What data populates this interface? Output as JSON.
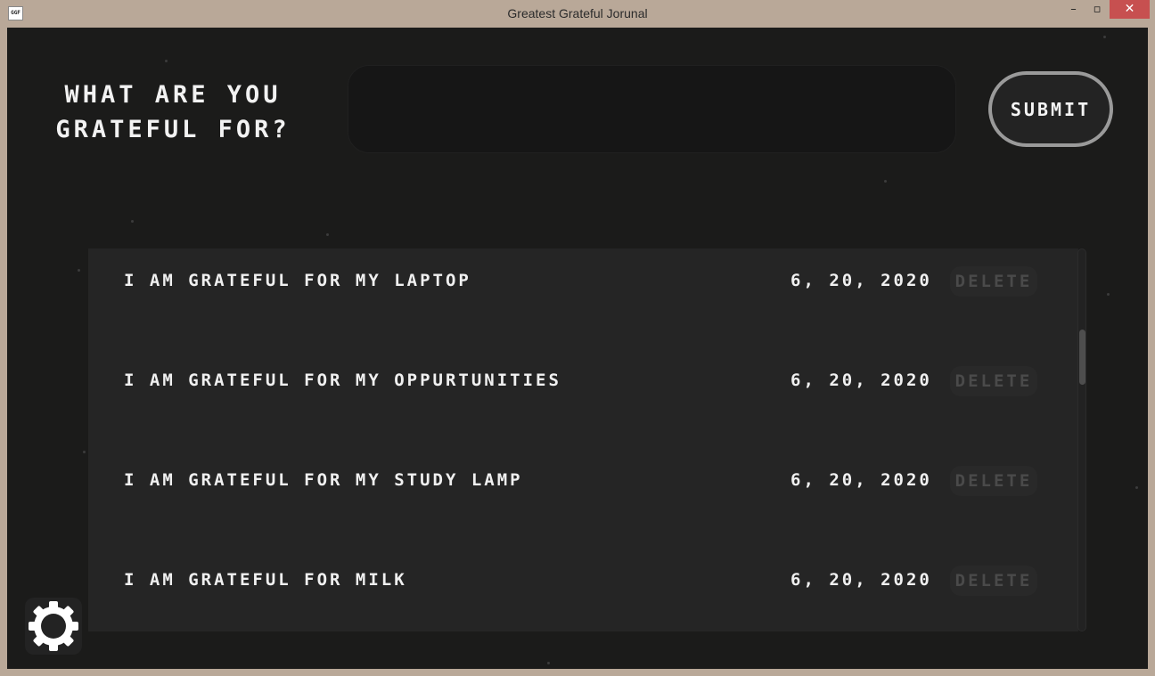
{
  "window": {
    "title": "Greatest Grateful Jorunal",
    "icon_text": "GGF",
    "minimize": "–",
    "maximize": "▫",
    "close": "✕"
  },
  "header": {
    "prompt": "WHAT ARE YOU GRATEFUL FOR?",
    "input_value": "",
    "submit_label": "SUBMIT"
  },
  "entries": [
    {
      "text": "I AM GRATEFUL FOR MY LAPTOP",
      "date": "6, 20, 2020",
      "delete_label": "DELETE"
    },
    {
      "text": "I AM GRATEFUL FOR MY OPPURTUNITIES",
      "date": "6, 20, 2020",
      "delete_label": "DELETE"
    },
    {
      "text": "I AM GRATEFUL FOR MY STUDY LAMP",
      "date": "6, 20, 2020",
      "delete_label": "DELETE"
    },
    {
      "text": "I AM GRATEFUL FOR MILK",
      "date": "6, 20, 2020",
      "delete_label": "DELETE"
    }
  ],
  "icons": {
    "settings": "gear-icon"
  },
  "colors": {
    "background": "#1b1b1a",
    "panel": "#252525",
    "text": "#f0f0f0",
    "frame": "#b9a898",
    "close_button": "#c75050"
  }
}
